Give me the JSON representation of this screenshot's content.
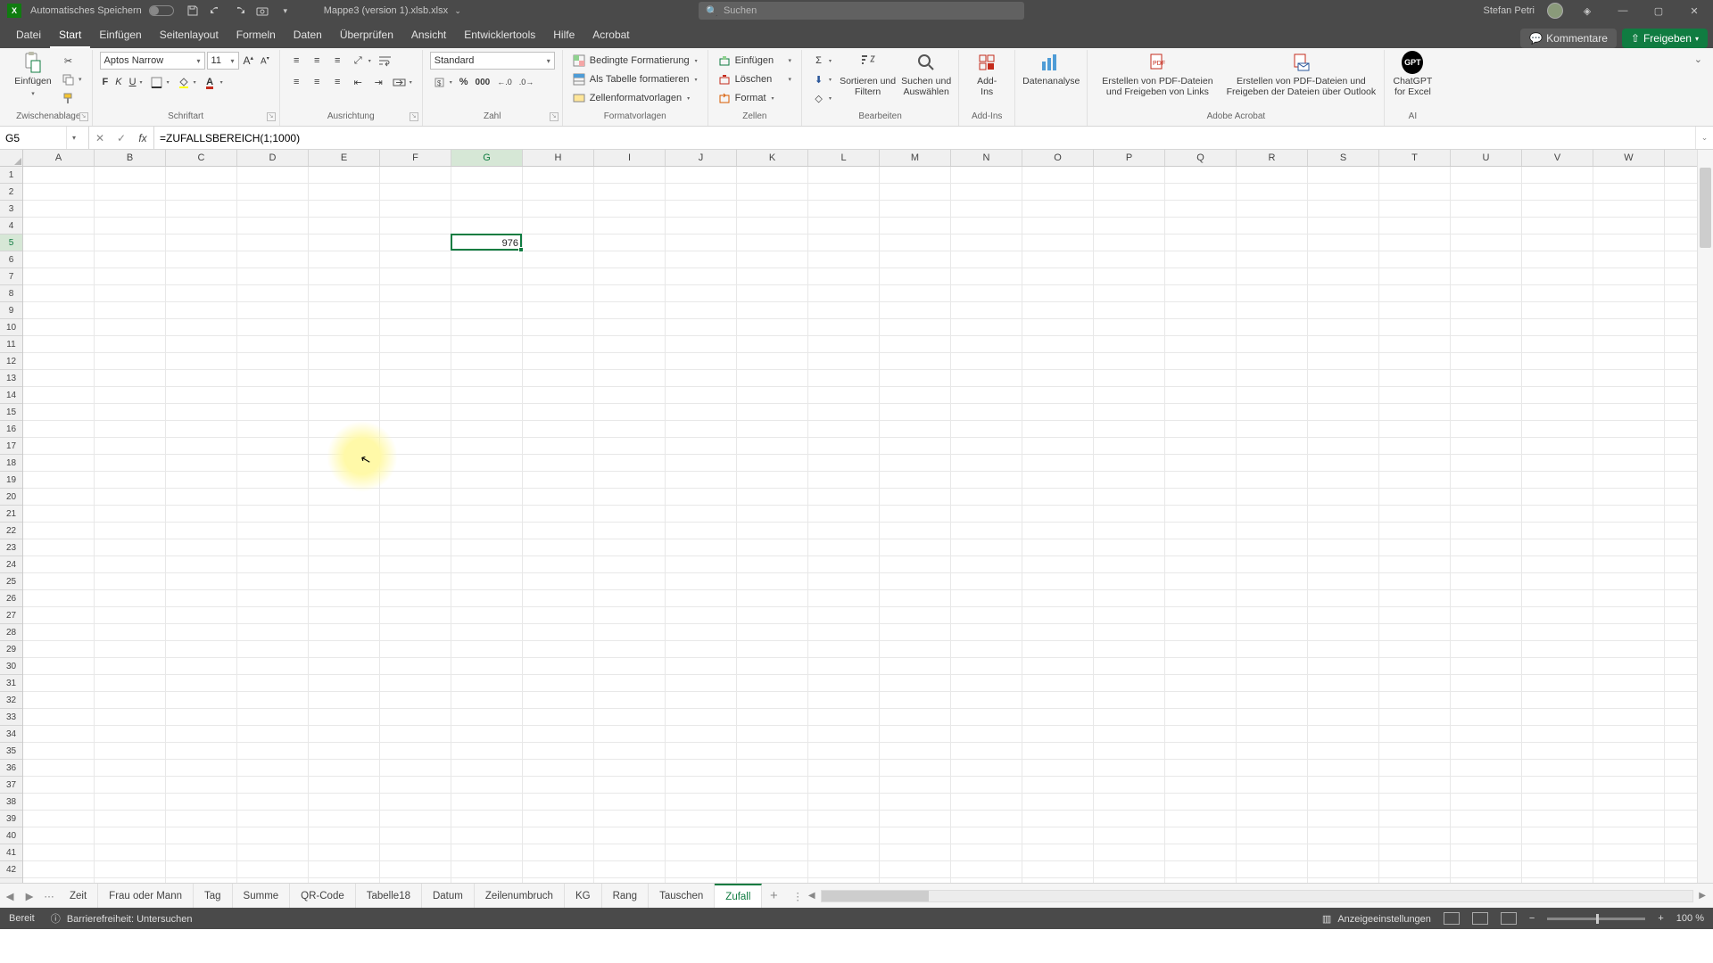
{
  "title_bar": {
    "autosave_label": "Automatisches Speichern",
    "doc_title": "Mappe3 (version 1).xlsb.xlsx",
    "search_placeholder": "Suchen",
    "user_name": "Stefan Petri"
  },
  "menu_tabs": [
    "Datei",
    "Start",
    "Einfügen",
    "Seitenlayout",
    "Formeln",
    "Daten",
    "Überprüfen",
    "Ansicht",
    "Entwicklertools",
    "Hilfe",
    "Acrobat"
  ],
  "menu_active_index": 1,
  "comments_btn": "Kommentare",
  "share_btn": "Freigeben",
  "ribbon": {
    "clipboard": {
      "label": "Zwischenablage",
      "paste": "Einfügen"
    },
    "font": {
      "label": "Schriftart",
      "family": "Aptos Narrow",
      "size": "11"
    },
    "alignment": {
      "label": "Ausrichtung"
    },
    "number": {
      "label": "Zahl",
      "format": "Standard"
    },
    "styles": {
      "label": "Formatvorlagen",
      "cond": "Bedingte Formatierung",
      "table": "Als Tabelle formatieren",
      "cell": "Zellenformatvorlagen"
    },
    "cells": {
      "label": "Zellen",
      "insert": "Einfügen",
      "delete": "Löschen",
      "format": "Format"
    },
    "editing": {
      "label": "Bearbeiten",
      "sort": "Sortieren und\nFiltern",
      "find": "Suchen und\nAuswählen"
    },
    "addins": {
      "label": "Add-Ins",
      "addins": "Add-\nIns"
    },
    "data_analysis": "Datenanalyse",
    "acrobat": {
      "label": "Adobe Acrobat",
      "pdf1": "Erstellen von PDF-Dateien\nund Freigeben von Links",
      "pdf2": "Erstellen von PDF-Dateien und\nFreigeben der Dateien über Outlook"
    },
    "ai": {
      "label": "AI",
      "gpt": "ChatGPT\nfor Excel"
    }
  },
  "name_box": "G5",
  "formula": "=ZUFALLSBEREICH(1;1000)",
  "columns": [
    "A",
    "B",
    "C",
    "D",
    "E",
    "F",
    "G",
    "H",
    "I",
    "J",
    "K",
    "L",
    "M",
    "N",
    "O",
    "P",
    "Q",
    "R",
    "S",
    "T",
    "U",
    "V",
    "W"
  ],
  "sel_col_index": 6,
  "sel_row": 5,
  "cell_value": "976",
  "sheet_tabs": [
    "Zeit",
    "Frau oder Mann",
    "Tag",
    "Summe",
    "QR-Code",
    "Tabelle18",
    "Datum",
    "Zeilenumbruch",
    "KG",
    "Rang",
    "Tauschen",
    "Zufall"
  ],
  "sheet_active_index": 11,
  "status": {
    "ready": "Bereit",
    "accessibility": "Barrierefreiheit: Untersuchen",
    "display_settings": "Anzeigeeinstellungen",
    "zoom": "100 %"
  }
}
